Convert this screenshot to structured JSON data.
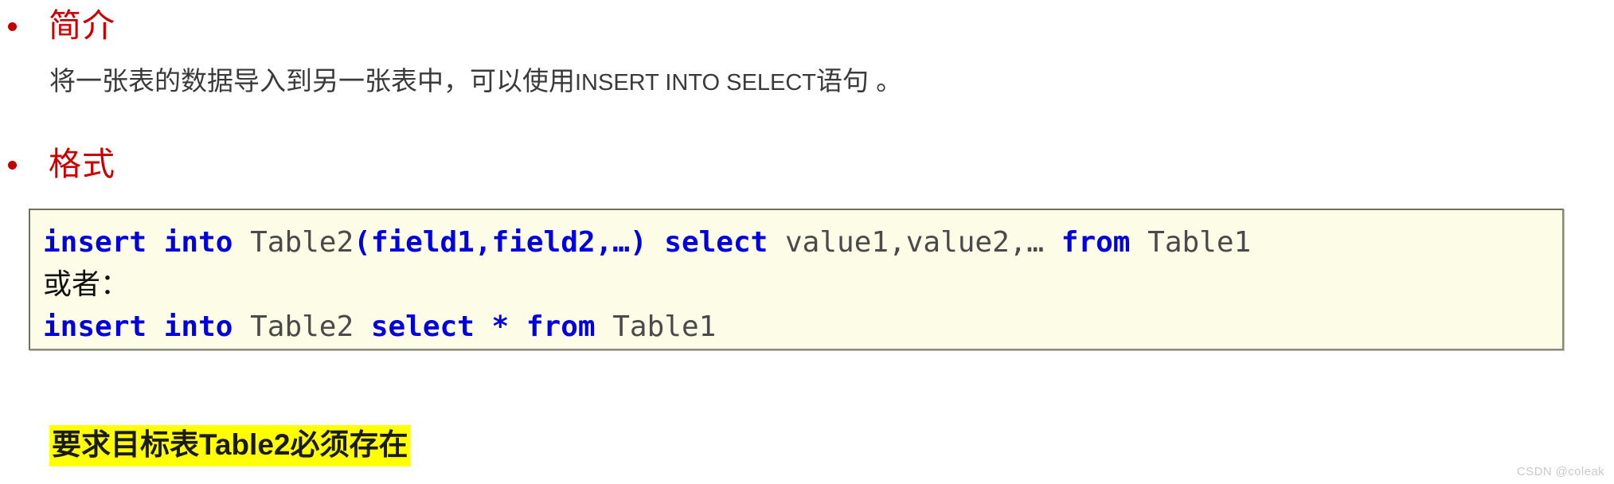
{
  "slide": {
    "background_color": "#ffffff",
    "accent_color": "#cc0000",
    "keyword_color": "#0000e0",
    "identifier_color": "#4a4a4a",
    "code_background": "#fdfce6",
    "highlight_color": "#ffff00"
  },
  "sections": {
    "intro": {
      "bullet_glyph": "•",
      "heading": "简介",
      "body": "将一张表的数据导入到另一张表中，可以使用",
      "body_latin": "INSERT INTO SELECT",
      "body_tail": "语句 。"
    },
    "format": {
      "bullet_glyph": "•",
      "heading": "格式"
    }
  },
  "code_block": {
    "line1": {
      "kw1": "insert into ",
      "id1": "Table2",
      "kw2": "(field1,field2,…) ",
      "kw3": "select ",
      "id2": "value1,value2,… ",
      "kw4": "from ",
      "id3": "Table1"
    },
    "line2": {
      "text": "或者："
    },
    "line3": {
      "kw1": "insert into ",
      "id1": "Table2 ",
      "kw2": "select * from ",
      "id2": "Table1"
    }
  },
  "note": {
    "text": "要求目标表Table2必须存在"
  },
  "watermark": {
    "text": "CSDN @coleak"
  }
}
